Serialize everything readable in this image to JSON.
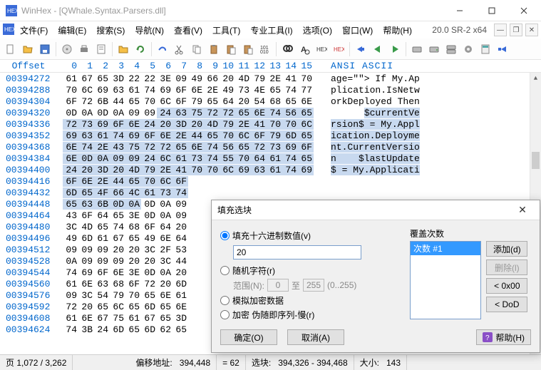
{
  "window": {
    "app": "WinHex",
    "doc": "[QWhale.Syntax.Parsers.dll]",
    "version": "20.0 SR-2 x64"
  },
  "menu": {
    "file": "文件(F)",
    "edit": "编辑(E)",
    "search": "搜索(S)",
    "nav": "导航(N)",
    "view": "查看(V)",
    "tools": "工具(T)",
    "spec": "专业工具(I)",
    "options": "选项(O)",
    "window": "窗口(W)",
    "help": "帮助(H)"
  },
  "hex": {
    "offset_label": "Offset",
    "ascii_label": "ANSI ASCII",
    "cols": [
      "0",
      "1",
      "2",
      "3",
      "4",
      "5",
      "6",
      "7",
      "8",
      "9",
      "10",
      "11",
      "12",
      "13",
      "14",
      "15"
    ],
    "rows": [
      {
        "off": "00394272",
        "b": [
          "61",
          "67",
          "65",
          "3D",
          "22",
          "22",
          "3E",
          "09",
          "49",
          "66",
          "20",
          "4D",
          "79",
          "2E",
          "41",
          "70"
        ],
        "a": "age=\"\"> If My.Ap",
        "sel": []
      },
      {
        "off": "00394288",
        "b": [
          "70",
          "6C",
          "69",
          "63",
          "61",
          "74",
          "69",
          "6F",
          "6E",
          "2E",
          "49",
          "73",
          "4E",
          "65",
          "74",
          "77"
        ],
        "a": "plication.IsNetw",
        "sel": []
      },
      {
        "off": "00394304",
        "b": [
          "6F",
          "72",
          "6B",
          "44",
          "65",
          "70",
          "6C",
          "6F",
          "79",
          "65",
          "64",
          "20",
          "54",
          "68",
          "65",
          "6E"
        ],
        "a": "orkDeployed Then",
        "sel": []
      },
      {
        "off": "00394320",
        "b": [
          "0D",
          "0A",
          "0D",
          "0A",
          "09",
          "09",
          "24",
          "63",
          "75",
          "72",
          "72",
          "65",
          "6E",
          "74",
          "56",
          "65"
        ],
        "a": "      $currentVe",
        "sel": [
          6,
          7,
          8,
          9,
          10,
          11,
          12,
          13,
          14,
          15
        ],
        "asel": [
          6,
          15
        ]
      },
      {
        "off": "00394336",
        "b": [
          "72",
          "73",
          "69",
          "6F",
          "6E",
          "24",
          "20",
          "3D",
          "20",
          "4D",
          "79",
          "2E",
          "41",
          "70",
          "70",
          "6C"
        ],
        "a": "rsion$ = My.Appl",
        "sel": [
          0,
          1,
          2,
          3,
          4,
          5,
          6,
          7,
          8,
          9,
          10,
          11,
          12,
          13,
          14,
          15
        ],
        "asel": [
          0,
          15
        ]
      },
      {
        "off": "00394352",
        "b": [
          "69",
          "63",
          "61",
          "74",
          "69",
          "6F",
          "6E",
          "2E",
          "44",
          "65",
          "70",
          "6C",
          "6F",
          "79",
          "6D",
          "65"
        ],
        "a": "ication.Deployme",
        "sel": [
          0,
          1,
          2,
          3,
          4,
          5,
          6,
          7,
          8,
          9,
          10,
          11,
          12,
          13,
          14,
          15
        ],
        "asel": [
          0,
          15
        ]
      },
      {
        "off": "00394368",
        "b": [
          "6E",
          "74",
          "2E",
          "43",
          "75",
          "72",
          "72",
          "65",
          "6E",
          "74",
          "56",
          "65",
          "72",
          "73",
          "69",
          "6F"
        ],
        "a": "nt.CurrentVersio",
        "sel": [
          0,
          1,
          2,
          3,
          4,
          5,
          6,
          7,
          8,
          9,
          10,
          11,
          12,
          13,
          14,
          15
        ],
        "asel": [
          0,
          15
        ]
      },
      {
        "off": "00394384",
        "b": [
          "6E",
          "0D",
          "0A",
          "09",
          "09",
          "24",
          "6C",
          "61",
          "73",
          "74",
          "55",
          "70",
          "64",
          "61",
          "74",
          "65"
        ],
        "a": "n    $lastUpdate",
        "sel": [
          0,
          1,
          2,
          3,
          4,
          5,
          6,
          7,
          8,
          9,
          10,
          11,
          12,
          13,
          14,
          15
        ],
        "asel": [
          0,
          15
        ]
      },
      {
        "off": "00394400",
        "b": [
          "24",
          "20",
          "3D",
          "20",
          "4D",
          "79",
          "2E",
          "41",
          "70",
          "70",
          "6C",
          "69",
          "63",
          "61",
          "74",
          "69"
        ],
        "a": "$ = My.Applicati",
        "sel": [
          0,
          1,
          2,
          3,
          4,
          5,
          6,
          7,
          8,
          9,
          10,
          11,
          12,
          13,
          14,
          15
        ],
        "asel": [
          0,
          15
        ]
      },
      {
        "off": "00394416",
        "b": [
          "6F",
          "6E",
          "2E",
          "44",
          "65",
          "70",
          "6C",
          "6F"
        ],
        "a": "",
        "sel": [
          0,
          1,
          2,
          3,
          4,
          5,
          6,
          7
        ]
      },
      {
        "off": "00394432",
        "b": [
          "6D",
          "65",
          "4F",
          "66",
          "4C",
          "61",
          "73",
          "74"
        ],
        "a": "",
        "sel": [
          0,
          1,
          2,
          3,
          4,
          5,
          6,
          7
        ]
      },
      {
        "off": "00394448",
        "b": [
          "65",
          "63",
          "6B",
          "0D",
          "0A",
          "0D",
          "0A",
          "09"
        ],
        "a": "",
        "sel": [
          0,
          1,
          2,
          3,
          4
        ]
      },
      {
        "off": "00394464",
        "b": [
          "43",
          "6F",
          "64",
          "65",
          "3E",
          "0D",
          "0A",
          "09"
        ],
        "a": "",
        "sel": []
      },
      {
        "off": "00394480",
        "b": [
          "3C",
          "4D",
          "65",
          "74",
          "68",
          "6F",
          "64",
          "20"
        ],
        "a": "",
        "sel": []
      },
      {
        "off": "00394496",
        "b": [
          "49",
          "6D",
          "61",
          "67",
          "65",
          "49",
          "6E",
          "64"
        ],
        "a": "",
        "sel": []
      },
      {
        "off": "00394512",
        "b": [
          "09",
          "09",
          "09",
          "20",
          "20",
          "3C",
          "2F",
          "53"
        ],
        "a": "",
        "sel": []
      },
      {
        "off": "00394528",
        "b": [
          "0A",
          "09",
          "09",
          "09",
          "20",
          "20",
          "3C",
          "44"
        ],
        "a": "",
        "sel": []
      },
      {
        "off": "00394544",
        "b": [
          "74",
          "69",
          "6F",
          "6E",
          "3E",
          "0D",
          "0A",
          "20"
        ],
        "a": "",
        "sel": []
      },
      {
        "off": "00394560",
        "b": [
          "61",
          "6E",
          "63",
          "68",
          "6F",
          "72",
          "20",
          "6D"
        ],
        "a": "",
        "sel": []
      },
      {
        "off": "00394576",
        "b": [
          "09",
          "3C",
          "54",
          "79",
          "70",
          "65",
          "6E",
          "61"
        ],
        "a": "",
        "sel": []
      },
      {
        "off": "00394592",
        "b": [
          "72",
          "20",
          "65",
          "6C",
          "65",
          "6D",
          "65",
          "6E"
        ],
        "a": "",
        "sel": []
      },
      {
        "off": "00394608",
        "b": [
          "61",
          "6E",
          "67",
          "75",
          "61",
          "67",
          "65",
          "3D"
        ],
        "a": "",
        "sel": []
      },
      {
        "off": "00394624",
        "b": [
          "74",
          "3B",
          "24",
          "6D",
          "65",
          "6D",
          "62",
          "65"
        ],
        "a": "",
        "sel": []
      }
    ]
  },
  "status": {
    "page": "页 1,072 / 3,262",
    "offaddr_lbl": "偏移地址:",
    "offaddr": "394,448",
    "eq": "= 62",
    "sel_lbl": "选块:",
    "sel": "394,326 - 394,468",
    "size_lbl": "大小:",
    "size": "143"
  },
  "dialog": {
    "title": "填充选块",
    "fill_hex": "填充十六进制数值(v)",
    "hex_value": "20",
    "random": "随机字符(r)",
    "range_lbl": "范围(N):",
    "range_from": "0",
    "range_to_lbl": "至",
    "range_to": "255",
    "range_hint": "(0..255)",
    "simulate": "模拟加密数据",
    "encrypt": "加密 伪随即序列-慢(r)",
    "passes_lbl": "覆盖次数",
    "pass_item": "次数 #1",
    "add": "添加(d)",
    "del": "删除(l)",
    "zero": "< 0x00",
    "dod": "< DoD",
    "ok": "确定(O)",
    "cancel": "取消(A)",
    "help": "帮助(H)"
  }
}
